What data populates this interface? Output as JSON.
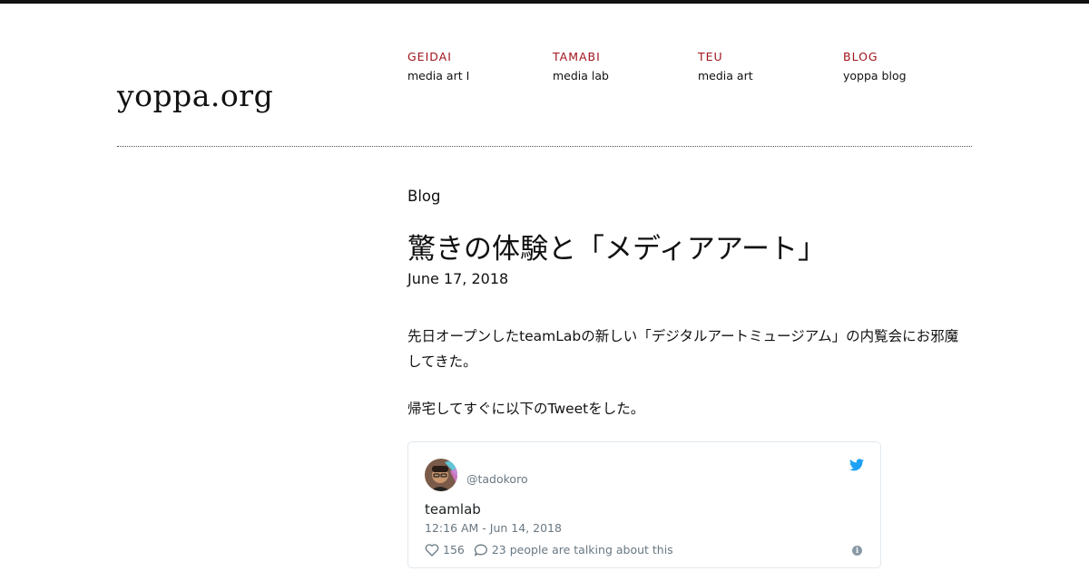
{
  "site": {
    "logo": "yoppa.org"
  },
  "nav": [
    {
      "title": "GEIDAI",
      "sub": "media art I"
    },
    {
      "title": "TAMABI",
      "sub": "media lab"
    },
    {
      "title": "TEU",
      "sub": "media art"
    },
    {
      "title": "BLOG",
      "sub": "yoppa blog"
    }
  ],
  "post": {
    "section": "Blog",
    "title": "驚きの体験と「メディアアート」",
    "date": "June 17, 2018",
    "paragraph1": "先日オープンしたteamLabの新しい「デジタルアートミュージアム」の内覧会にお邪魔してきた。",
    "paragraph2": "帰宅してすぐに以下のTweetをした。"
  },
  "tweet": {
    "handle": "@tadokoro",
    "text": "teamlab",
    "time": "12:16 AM - Jun 14, 2018",
    "likes": "156",
    "replies": "23 people are talking about this",
    "info": "i"
  },
  "colors": {
    "nav_accent": "#a0141c",
    "twitter_blue": "#1da1f2",
    "meta_gray": "#697882"
  }
}
